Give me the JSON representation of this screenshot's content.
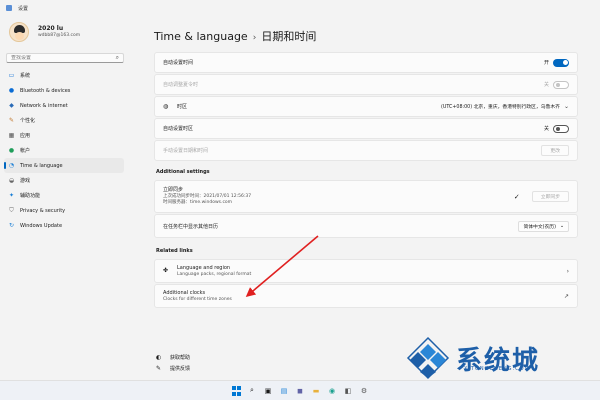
{
  "window": {
    "title": "设置"
  },
  "profile": {
    "name": "2020 lu",
    "email": "wdbb87@163.com"
  },
  "search": {
    "placeholder": "查找设置"
  },
  "nav": {
    "items": [
      {
        "label": "系统",
        "icon": "monitor-icon"
      },
      {
        "label": "Bluetooth & devices",
        "icon": "bluetooth-icon"
      },
      {
        "label": "Network & internet",
        "icon": "wifi-icon"
      },
      {
        "label": "个性化",
        "icon": "brush-icon"
      },
      {
        "label": "应用",
        "icon": "apps-icon"
      },
      {
        "label": "帐户",
        "icon": "person-icon"
      },
      {
        "label": "Time & language",
        "icon": "globe-clock-icon",
        "active": true
      },
      {
        "label": "游戏",
        "icon": "gamepad-icon"
      },
      {
        "label": "辅助功能",
        "icon": "accessibility-icon"
      },
      {
        "label": "Privacy & security",
        "icon": "shield-icon"
      },
      {
        "label": "Windows Update",
        "icon": "update-icon"
      }
    ]
  },
  "header": {
    "section": "Time & language",
    "page": "日期和时间"
  },
  "settings": {
    "auto_time": {
      "label": "自动设置时间",
      "state": "开"
    },
    "auto_dst": {
      "label": "自动调整夏令时",
      "state": "关"
    },
    "timezone": {
      "label": "时区",
      "value": "(UTC+08:00) 北京，重庆，香港特别行政区，乌鲁木齐"
    },
    "auto_timezone": {
      "label": "自动设置时区",
      "state": "关"
    },
    "manual_set": {
      "label": "手动设置日期和时间",
      "button": "更改"
    }
  },
  "additional": {
    "heading": "Additional settings",
    "sync": {
      "label": "立即同步",
      "line1": "上次成功同步时间：2021/07/01 12:56:37",
      "line2": "时间服务器：time.windows.com",
      "button": "立即同步"
    },
    "calendar": {
      "label": "在任务栏中显示其他日历",
      "value": "简体中文(农历)"
    }
  },
  "related": {
    "heading": "Related links",
    "language": {
      "label": "Language and region",
      "sub": "Language packs, regional format"
    },
    "clocks": {
      "label": "Additional clocks",
      "sub": "Clocks for different time zones"
    }
  },
  "footer": {
    "help": "获取帮助",
    "feedback": "提供反馈"
  },
  "watermark": {
    "text": "系统城",
    "sub": "XITONGCHENG.COM"
  },
  "colors": {
    "accent": "#0067c0",
    "annotation": "#e02020",
    "watermark": "#1e5fa8"
  }
}
